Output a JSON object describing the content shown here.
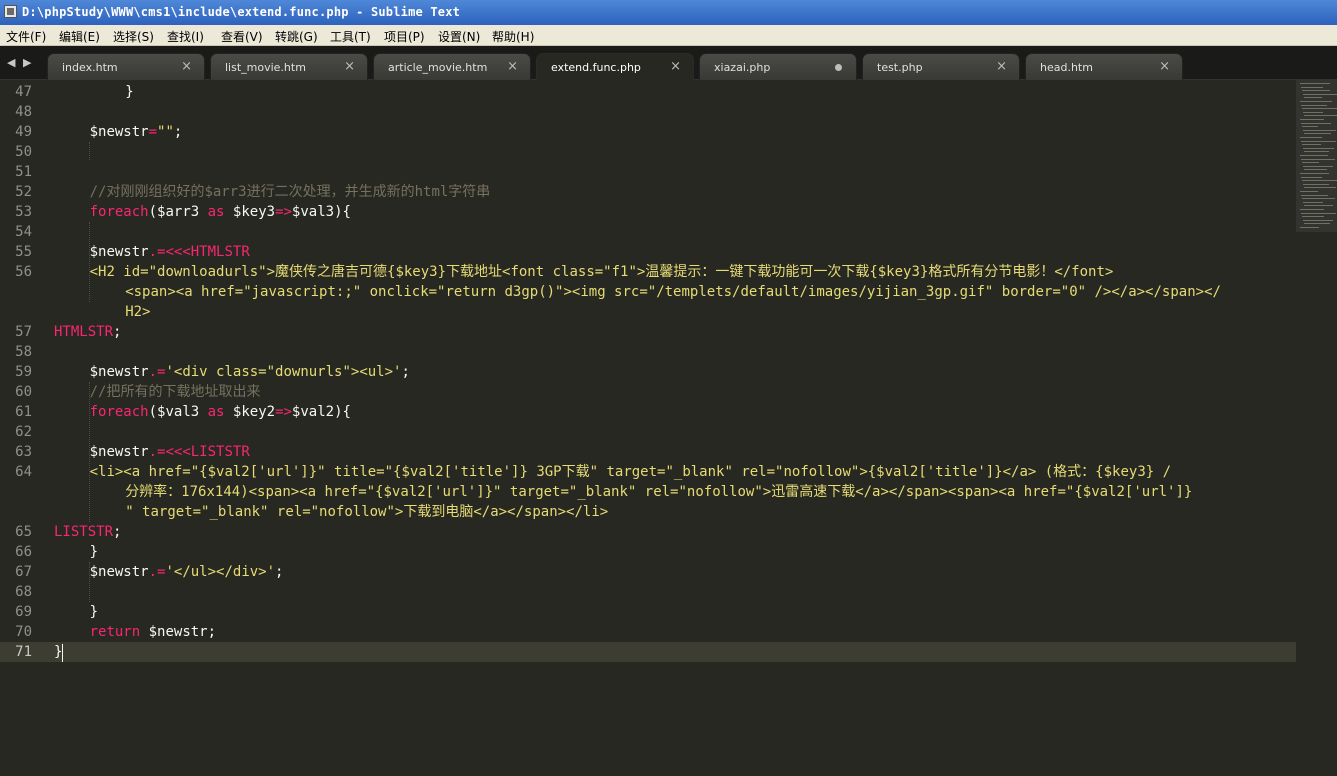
{
  "window": {
    "title": "D:\\phpStudy\\WWW\\cms1\\include\\extend.func.php - Sublime Text"
  },
  "menu": [
    "文件(F)",
    "编辑(E)",
    "选择(S)",
    "查找(I)",
    "查看(V)",
    "转跳(G)",
    "工具(T)",
    "项目(P)",
    "设置(N)",
    "帮助(H)"
  ],
  "tabs": [
    {
      "label": "index.htm",
      "active": false,
      "dirty": false
    },
    {
      "label": "list_movie.htm",
      "active": false,
      "dirty": false
    },
    {
      "label": "article_movie.htm",
      "active": false,
      "dirty": false
    },
    {
      "label": "extend.func.php",
      "active": true,
      "dirty": false
    },
    {
      "label": "xiazai.php",
      "active": false,
      "dirty": true
    },
    {
      "label": "test.php",
      "active": false,
      "dirty": false
    },
    {
      "label": "head.htm",
      "active": false,
      "dirty": false
    }
  ],
  "nav": {
    "back_glyph": "◀",
    "forward_glyph": "▶",
    "close_glyph": "×"
  },
  "colors": {
    "background": "#272822",
    "keyword": "#f92672",
    "string": "#e6db74",
    "comment": "#75715e",
    "function": "#66d9ef"
  },
  "editor": {
    "current_line": 71,
    "line_numbers": [
      "47",
      "48",
      "49",
      "50",
      "51",
      "52",
      "53",
      "54",
      "55",
      "56",
      "57",
      "58",
      "59",
      "60",
      "61",
      "62",
      "63",
      "64",
      "65",
      "66",
      "67",
      "68",
      "69",
      "70",
      "71"
    ],
    "lines": [
      [
        [
          "v",
          "        }"
        ]
      ],
      [],
      [
        [
          "v",
          "    $newstr"
        ],
        [
          "k",
          "="
        ],
        [
          "s",
          "\"\""
        ],
        [
          "v",
          ";"
        ]
      ],
      [],
      [],
      [
        [
          "c",
          "    //对刚刚组织好的$arr3进行二次处理，并生成新的html字符串"
        ]
      ],
      [
        [
          "k",
          "    foreach"
        ],
        [
          "v",
          "($arr3 "
        ],
        [
          "k",
          "as"
        ],
        [
          "v",
          " $key3"
        ],
        [
          "k",
          "=>"
        ],
        [
          "v",
          "$val3){"
        ]
      ],
      [],
      [
        [
          "v",
          "    $newstr"
        ],
        [
          "k",
          ".="
        ],
        [
          "k",
          "<<<HTMLSTR"
        ]
      ],
      [
        [
          "s",
          "    <H2 id=\"downloadurls\">魔侠传之唐吉可德{$key3}下载地址<font class=\"f1\">温馨提示：一键下载功能可一次下载{$key3}格式所有分节电影！</font>"
        ]
      ],
      [
        [
          "s",
          "        <span><a href=\"javascript:;\" onclick=\"return d3gp()\"><img src=\"/templets/default/images/yijian_3gp.gif\" border=\"0\" /></a></span></"
        ]
      ],
      [
        [
          "s",
          "        H2>"
        ]
      ],
      [
        [
          "k",
          "HTMLSTR"
        ],
        [
          "v",
          ";"
        ]
      ],
      [],
      [
        [
          "v",
          "    $newstr"
        ],
        [
          "k",
          ".="
        ],
        [
          "s",
          "'<div class=\"downurls\"><ul>'"
        ],
        [
          "v",
          ";"
        ]
      ],
      [
        [
          "c",
          "    //把所有的下载地址取出来"
        ]
      ],
      [
        [
          "k",
          "    foreach"
        ],
        [
          "v",
          "($val3 "
        ],
        [
          "k",
          "as"
        ],
        [
          "v",
          " $key2"
        ],
        [
          "k",
          "=>"
        ],
        [
          "v",
          "$val2){"
        ]
      ],
      [],
      [
        [
          "v",
          "    $newstr"
        ],
        [
          "k",
          ".="
        ],
        [
          "k",
          "<<<LISTSTR"
        ]
      ],
      [
        [
          "s",
          "    <li><a href=\"{$val2['url']}\" title=\"{$val2['title']} 3GP下载\" target=\"_blank\" rel=\"nofollow\">{$val2['title']}</a> (格式：{$key3} /"
        ]
      ],
      [
        [
          "s",
          "        分辨率：176x144)<span><a href=\"{$val2['url']}\" target=\"_blank\" rel=\"nofollow\">迅雷高速下载</a></span><span><a href=\"{$val2['url']}"
        ]
      ],
      [
        [
          "s",
          "        \" target=\"_blank\" rel=\"nofollow\">下载到电脑</a></span></li>"
        ]
      ],
      [
        [
          "k",
          "LISTSTR"
        ],
        [
          "v",
          ";"
        ]
      ],
      [
        [
          "v",
          "    }"
        ]
      ],
      [
        [
          "v",
          "    $newstr"
        ],
        [
          "k",
          ".="
        ],
        [
          "s",
          "'</ul></div>'"
        ],
        [
          "v",
          ";"
        ]
      ],
      [],
      [
        [
          "v",
          "    }"
        ]
      ],
      [
        [
          "k",
          "    return"
        ],
        [
          "v",
          " $newstr;"
        ]
      ],
      [
        [
          "v",
          "}"
        ]
      ]
    ]
  }
}
